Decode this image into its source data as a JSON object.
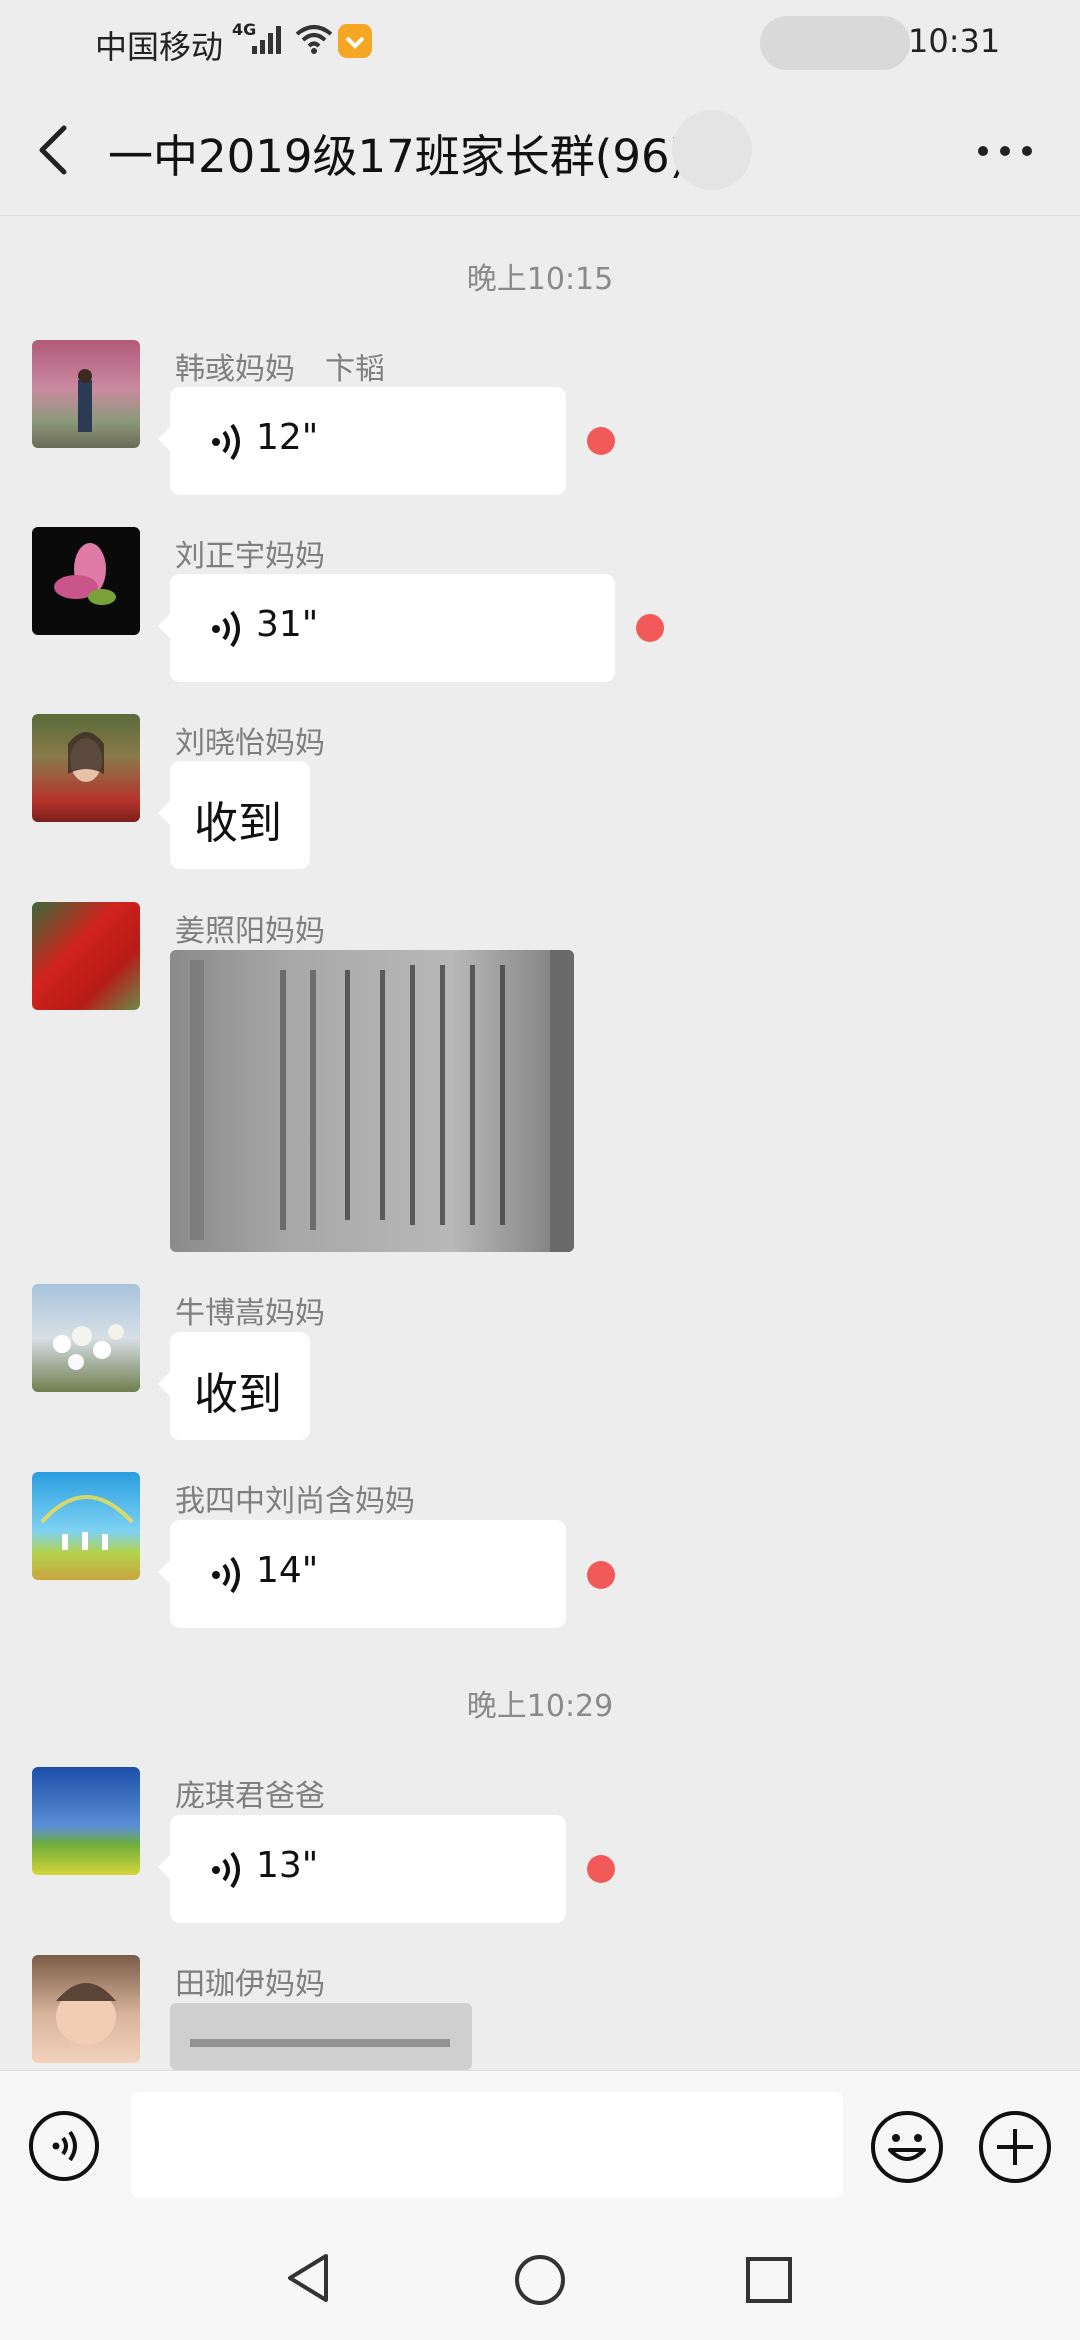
{
  "status_bar": {
    "carrier": "中国移动",
    "network": "4G",
    "time": "10:31",
    "icons": [
      "signal-icon",
      "wifi-icon",
      "app-badge-icon"
    ]
  },
  "header": {
    "back_icon": "chevron-left-icon",
    "title": "一中2019级17班家长群(96)",
    "more_icon": "more-dots-icon"
  },
  "timestamps": [
    "晚上10:15",
    "晚上10:29"
  ],
  "messages": [
    {
      "sender": "韩彧妈妈　卞韬",
      "type": "voice",
      "duration": "12\"",
      "unread": true
    },
    {
      "sender": "刘正宇妈妈",
      "type": "voice",
      "duration": "31\"",
      "unread": true
    },
    {
      "sender": "刘晓怡妈妈",
      "type": "text",
      "text": "收到"
    },
    {
      "sender": "姜照阳妈妈",
      "type": "image"
    },
    {
      "sender": "牛博嵩妈妈",
      "type": "text",
      "text": "收到"
    },
    {
      "sender": "我四中刘尚含妈妈",
      "type": "voice",
      "duration": "14\"",
      "unread": true
    },
    {
      "sender": "庞琪君爸爸",
      "type": "voice",
      "duration": "13\"",
      "unread": true
    },
    {
      "sender": "田珈伊妈妈",
      "type": "image"
    }
  ],
  "input_bar": {
    "input_value": "",
    "icons": [
      "voice-toggle-icon",
      "emoji-icon",
      "plus-icon"
    ]
  },
  "nav_bar": {
    "icons": [
      "nav-back-icon",
      "nav-home-icon",
      "nav-recents-icon"
    ]
  },
  "colors": {
    "background": "#ededed",
    "bubble": "#ffffff",
    "unread_dot": "#f25a5a",
    "timestamp_text": "#8a8a8a",
    "sender_text": "#7f7f7f"
  }
}
